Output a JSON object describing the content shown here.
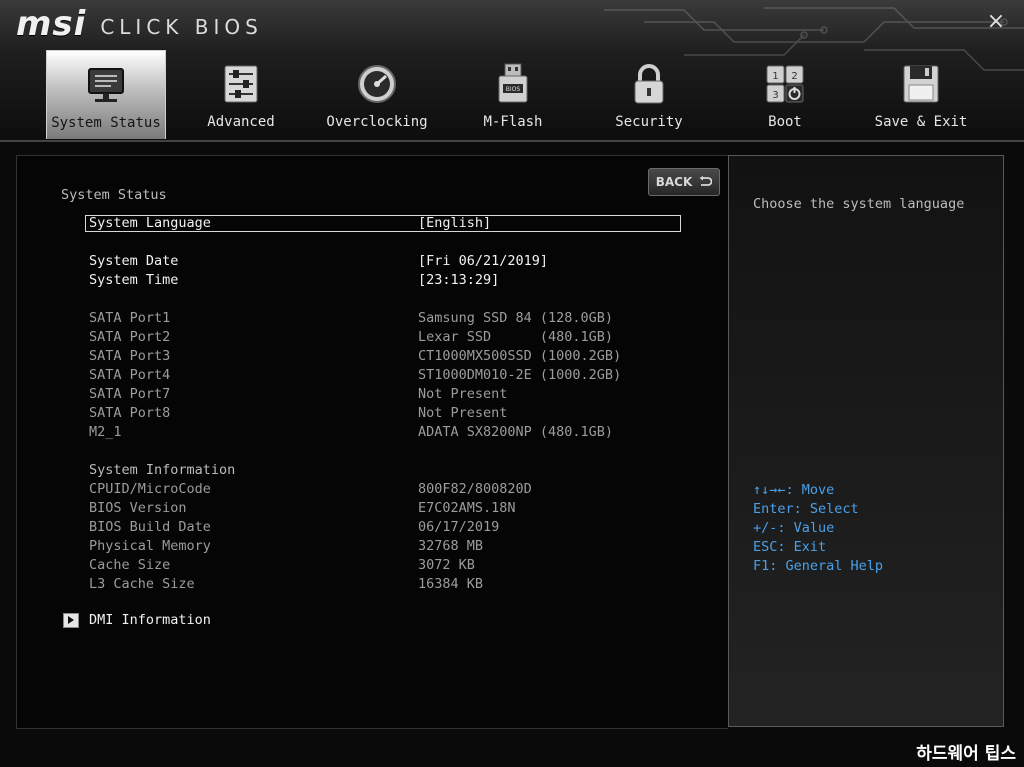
{
  "header": {
    "brand": "msi",
    "product": "CLICK BIOS",
    "close_symbol": "×"
  },
  "tabs": [
    {
      "label": "System Status",
      "icon": "monitor-icon",
      "active": true
    },
    {
      "label": "Advanced",
      "icon": "sliders-icon",
      "active": false
    },
    {
      "label": "Overclocking",
      "icon": "gauge-icon",
      "active": false
    },
    {
      "label": "M-Flash",
      "icon": "usb-bios-icon",
      "active": false
    },
    {
      "label": "Security",
      "icon": "lock-icon",
      "active": false
    },
    {
      "label": "Boot",
      "icon": "power-boot-icon",
      "active": false
    },
    {
      "label": "Save & Exit",
      "icon": "floppy-icon",
      "active": false
    }
  ],
  "main": {
    "back_label": "BACK",
    "section_title": "System Status",
    "language": {
      "label": "System Language",
      "value": "[English]"
    },
    "date": {
      "label": "System Date",
      "value": "[Fri 06/21/2019]"
    },
    "time": {
      "label": "System Time",
      "value": "[23:13:29]"
    },
    "storage": [
      {
        "label": "SATA Port1",
        "value": "Samsung SSD 84 (128.0GB)"
      },
      {
        "label": "SATA Port2",
        "value": "Lexar SSD      (480.1GB)"
      },
      {
        "label": "SATA Port3",
        "value": "CT1000MX500SSD (1000.2GB)"
      },
      {
        "label": "SATA Port4",
        "value": "ST1000DM010-2E (1000.2GB)"
      },
      {
        "label": "SATA Port7",
        "value": "Not Present"
      },
      {
        "label": "SATA Port8",
        "value": "Not Present"
      },
      {
        "label": "M2_1",
        "value": "ADATA SX8200NP (480.1GB)"
      }
    ],
    "system_info_title": "System Information",
    "system_info": [
      {
        "label": "CPUID/MicroCode",
        "value": "800F82/800820D"
      },
      {
        "label": "BIOS Version",
        "value": "E7C02AMS.18N"
      },
      {
        "label": "BIOS Build Date",
        "value": "06/17/2019"
      },
      {
        "label": "Physical Memory",
        "value": "32768 MB"
      },
      {
        "label": "Cache Size",
        "value": "3072 KB"
      },
      {
        "label": "L3 Cache Size",
        "value": "16384 KB"
      }
    ],
    "dmi_label": "DMI Information"
  },
  "help": {
    "description": "Choose the system language",
    "keys": [
      "↑↓→←: Move",
      "Enter: Select",
      "+/-: Value",
      "ESC: Exit",
      "F1: General Help"
    ]
  },
  "watermark": "하드웨어 팁스",
  "colors": {
    "accent_blue": "#4aa0e8",
    "background": "#050505",
    "text_bright": "#f2f2f2",
    "text_dim": "#9c9c9c"
  }
}
